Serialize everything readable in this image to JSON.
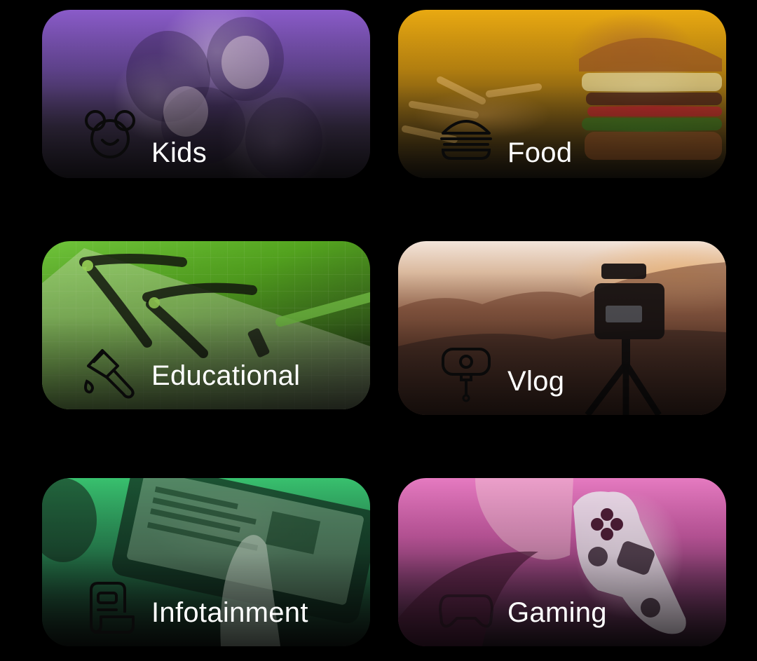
{
  "categories": [
    {
      "id": "kids",
      "label": "Kids",
      "icon": "mouse-ears-face-icon",
      "accent": "#8a5bc9"
    },
    {
      "id": "food",
      "label": "Food",
      "icon": "burger-icon",
      "accent": "#e9a911"
    },
    {
      "id": "educational",
      "label": "Educational",
      "icon": "paintbrush-icon",
      "accent": "#6fc43a"
    },
    {
      "id": "vlog",
      "label": "Vlog",
      "icon": "selfie-stick-camera-icon",
      "accent": "#e8c5a8"
    },
    {
      "id": "infotainment",
      "label": "Infotainment",
      "icon": "scroll-document-icon",
      "accent": "#38c06e"
    },
    {
      "id": "gaming",
      "label": "Gaming",
      "icon": "gamepad-icon",
      "accent": "#e57ac0"
    }
  ]
}
